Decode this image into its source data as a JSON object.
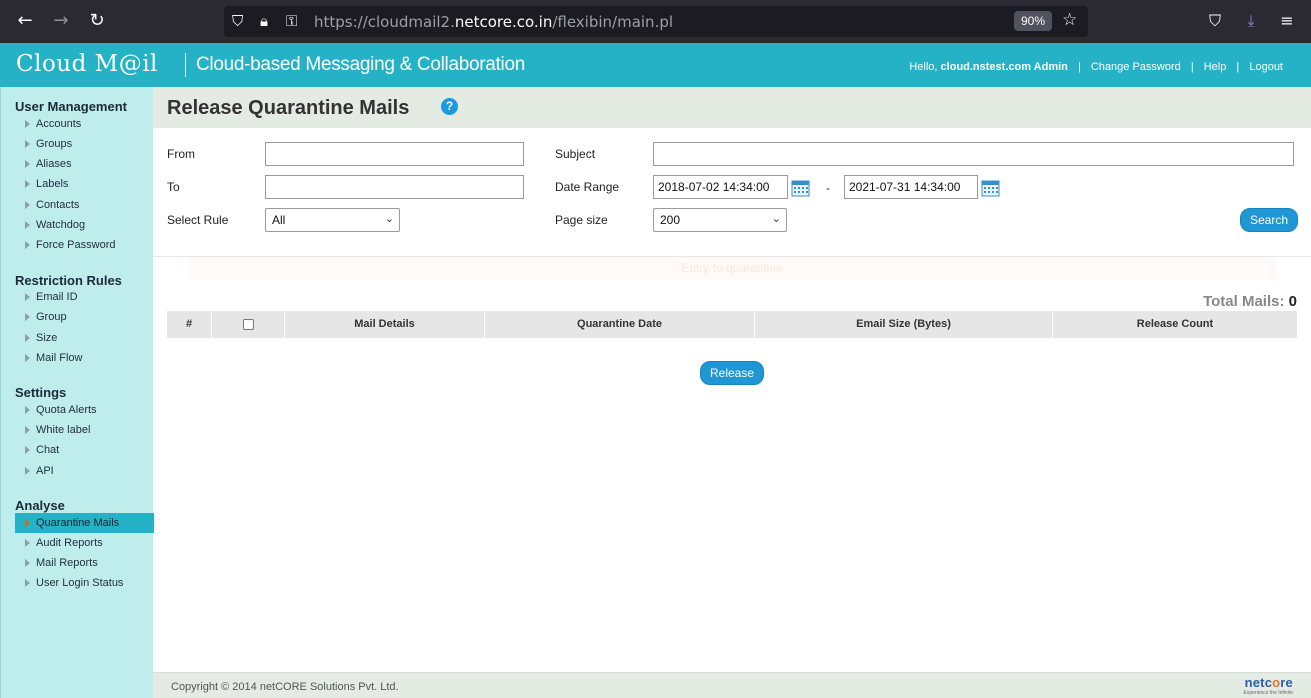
{
  "browser": {
    "url_prefix": "https://cloudmail2.",
    "url_domain": "netcore.co.in",
    "url_path": "/flexibin/main.pl",
    "zoom": "90%"
  },
  "header": {
    "logo": "Cloud M@il",
    "tagline": "Cloud-based Messaging & Collaboration",
    "hello": "Hello,",
    "user": "cloud.nstest.com Admin",
    "change_password": "Change Password",
    "help": "Help",
    "logout": "Logout"
  },
  "sidebar": {
    "user_management": {
      "title": "User Management",
      "items": [
        "Accounts",
        "Groups",
        "Aliases",
        "Labels",
        "Contacts",
        "Watchdog",
        "Force Password"
      ]
    },
    "restriction_rules": {
      "title": "Restriction Rules",
      "items": [
        "Email ID",
        "Group",
        "Size",
        "Mail Flow"
      ]
    },
    "settings": {
      "title": "Settings",
      "items": [
        "Quota Alerts",
        "White label",
        "Chat",
        "API"
      ]
    },
    "analyse": {
      "title": "Analyse",
      "items": [
        "Quarantine Mails",
        "Audit Reports",
        "Mail Reports",
        "User Login Status"
      ],
      "active": "Quarantine Mails"
    }
  },
  "main": {
    "title": "Release Quarantine Mails",
    "help_icon": "?",
    "form": {
      "from_label": "From",
      "from_value": "",
      "to_label": "To",
      "to_value": "",
      "select_rule_label": "Select Rule",
      "select_rule_value": "All",
      "subject_label": "Subject",
      "subject_value": "",
      "date_range_label": "Date Range",
      "date_from": "2018-07-02 14:34:00",
      "date_to": "2021-07-31 14:34:00",
      "date_separator": "-",
      "page_size_label": "Page size",
      "page_size_value": "200",
      "search_button": "Search"
    },
    "notice": "Entry to quarantine",
    "total_label": "Total Mails:",
    "total_count": "0",
    "table": {
      "columns": [
        "#",
        "",
        "Mail Details",
        "Quarantine Date",
        "Email Size (Bytes)",
        "Release Count"
      ]
    },
    "release_button": "Release"
  },
  "footer": {
    "copyright": "Copyright © 2014 netCORE Solutions Pvt. Ltd.",
    "brand_a": "netc",
    "brand_b": "o",
    "brand_c": "re",
    "brand_sub": "Experience the Infinite"
  },
  "colors": {
    "header_bg": "#25b2c6",
    "sidebar_bg": "#bfedec",
    "active_item": "#25b2c6",
    "button_blue": "#1f97d4"
  }
}
